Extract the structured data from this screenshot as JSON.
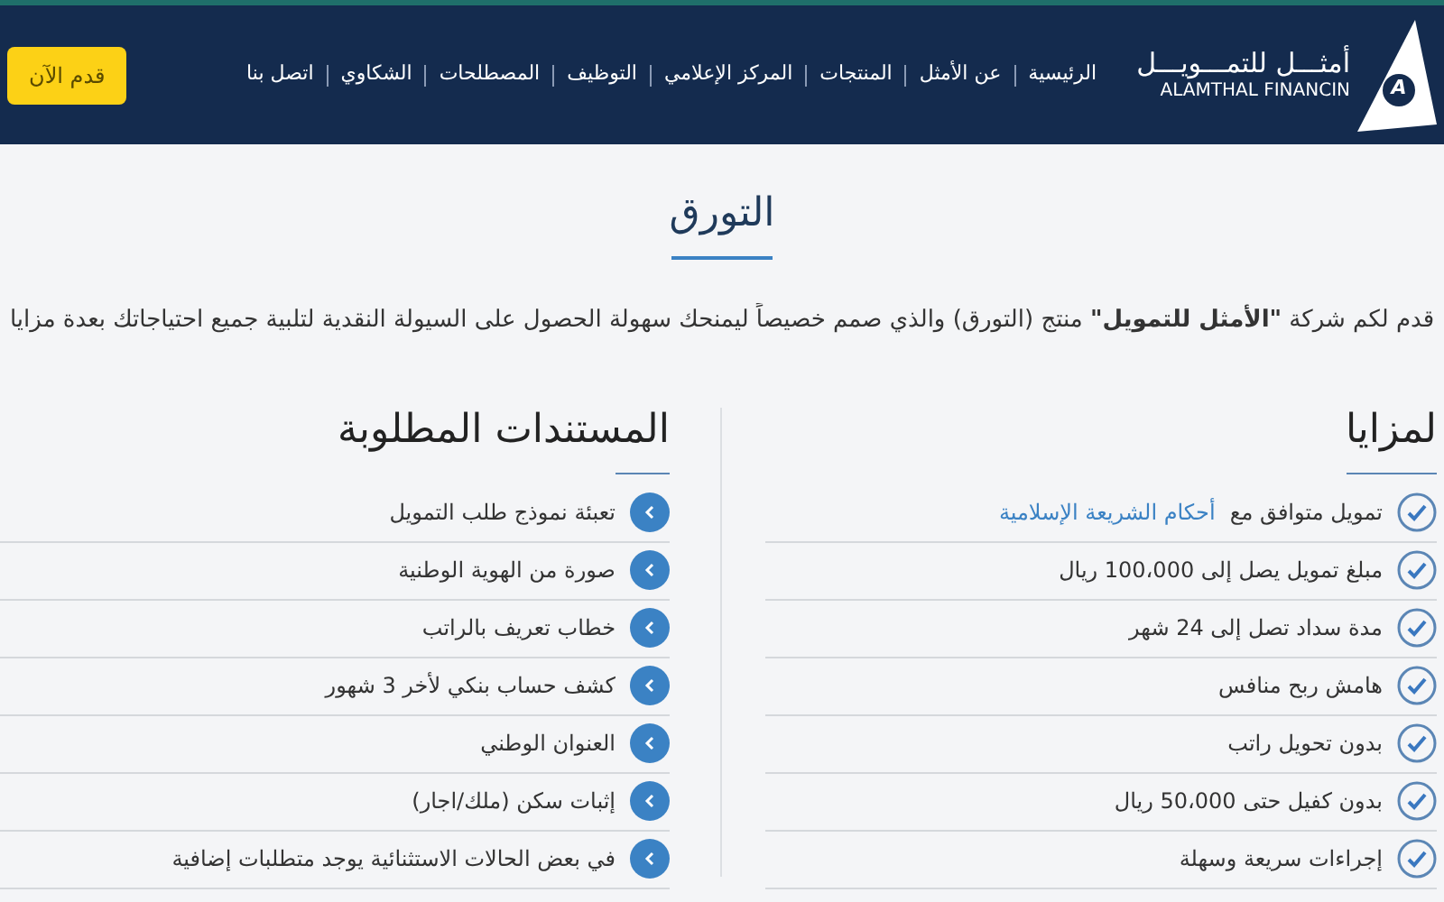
{
  "header": {
    "logo": {
      "letter": "A",
      "arabic": "أمثـــل للتمـــويـــل",
      "latin": "ALAMTHAL FINANCIN"
    },
    "nav": [
      "الرئيسية",
      "عن الأمثل",
      "المنتجات",
      "المركز الإعلامي",
      "التوظيف",
      "المصطلحات",
      "الشكاوي",
      "اتصل بنا"
    ],
    "cta": "قدم الآن"
  },
  "page_title": "التورق",
  "intro": "قدم لكم شركة **\"الأمثل للتمويل\"** منتج (التورق) والذي صمم خصيصاً ليمنحك سهولة الحصول على السيولة النقدية لتلبية جميع احتياجاتك بعدة مزايا",
  "features": {
    "title": "لمزايا",
    "items": [
      {
        "text": "تمويل متوافق مع",
        "link": "أحكام الشريعة الإسلامية"
      },
      {
        "text": "مبلغ تمويل يصل إلى 100،000 ريال"
      },
      {
        "text": "مدة سداد تصل إلى 24 شهر"
      },
      {
        "text": "هامش ربح منافس"
      },
      {
        "text": "بدون تحويل راتب"
      },
      {
        "text": "بدون كفيل حتى 50،000 ريال"
      },
      {
        "text": "إجراءات سريعة وسهلة"
      }
    ]
  },
  "documents": {
    "title": "المستندات المطلوبة",
    "items": [
      "تعبئة نموذج طلب التمويل",
      "صورة من الهوية الوطنية",
      "خطاب تعريف بالراتب",
      "كشف حساب بنكي لأخر 3 شهور",
      "العنوان الوطني",
      "إثبات سكن (ملك/اجار)",
      "في بعض الحالات الاستثنائية يوجد متطلبات إضافية"
    ]
  }
}
